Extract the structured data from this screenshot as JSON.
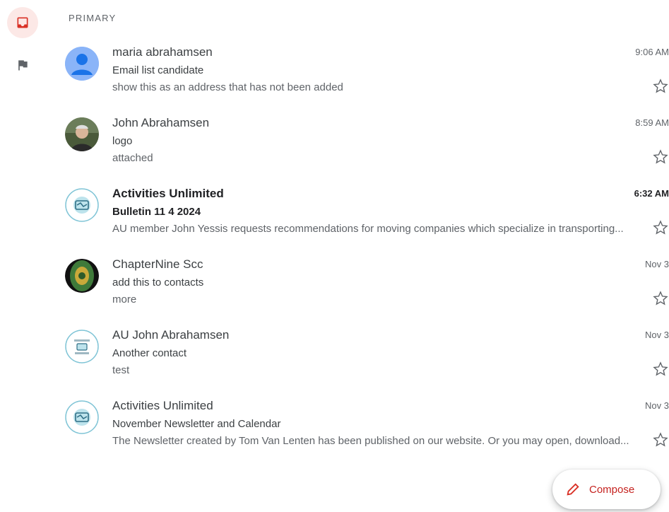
{
  "nav": {
    "inbox_icon": "inbox-icon",
    "flag_icon": "flag-icon"
  },
  "section": {
    "label": "PRIMARY"
  },
  "emails": [
    {
      "sender": "maria abrahamsen",
      "subject": "Email list candidate",
      "snippet": "show this as an address that has not been added",
      "time": "9:06 AM",
      "unread": false,
      "avatar": "default-person"
    },
    {
      "sender": "John Abrahamsen",
      "subject": "logo",
      "snippet": "attached",
      "time": "8:59 AM",
      "unread": false,
      "avatar": "photo"
    },
    {
      "sender": "Activities Unlimited",
      "subject": "Bulletin 11 4 2024",
      "snippet": "AU member John Yessis requests recommendations for moving companies which specialize in transporting...",
      "time": "6:32 AM",
      "unread": true,
      "avatar": "au-logo"
    },
    {
      "sender": "ChapterNine Scc",
      "subject": "add this to contacts",
      "snippet": "more",
      "time": "Nov 3",
      "unread": false,
      "avatar": "green-emblem"
    },
    {
      "sender": "AU John Abrahamsen",
      "subject": "Another contact",
      "snippet": "test",
      "time": "Nov 3",
      "unread": false,
      "avatar": "au-text-logo"
    },
    {
      "sender": "Activities Unlimited",
      "subject": "November Newsletter and Calendar",
      "snippet": "The Newsletter created by Tom Van Lenten has been published on our website. Or you may open, download...",
      "time": "Nov 3",
      "unread": false,
      "avatar": "au-logo"
    }
  ],
  "compose": {
    "label": "Compose"
  },
  "colors": {
    "accent_red": "#d93025",
    "inbox_bg": "#fce8e6",
    "default_avatar": "#8ab4f8"
  }
}
